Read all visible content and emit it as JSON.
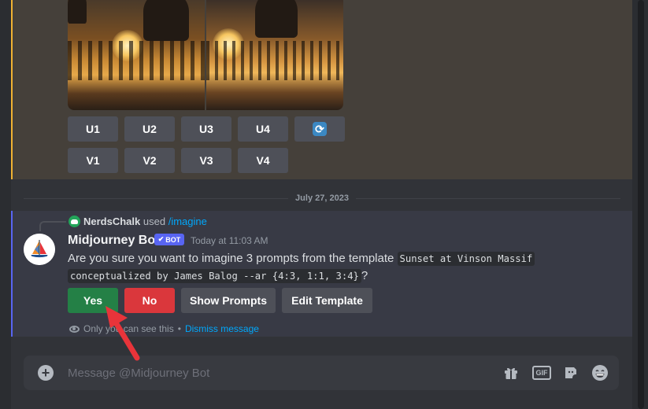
{
  "colors": {
    "background": "#313338",
    "top_message_bg": "#45403a",
    "top_accent": "#f0b232",
    "bottom_message_bg": "#383a45",
    "bottom_accent": "#5865f2",
    "button_secondary": "#4e5058",
    "button_success": "#248046",
    "button_danger": "#da373c",
    "link": "#00a8fc",
    "annotation_arrow": "#e8343a"
  },
  "image_grid": {
    "upscale_buttons": [
      "U1",
      "U2",
      "U3",
      "U4"
    ],
    "reroll_icon": "refresh-icon",
    "variation_buttons": [
      "V1",
      "V2",
      "V3",
      "V4"
    ]
  },
  "date_divider": "July 27, 2023",
  "reply": {
    "icon": "discord-icon",
    "user": "NerdsChalk",
    "used": "used",
    "command": "/imagine"
  },
  "message": {
    "author": "Midjourney Bot",
    "badge": "BOT",
    "timestamp": "Today at 11:03 AM",
    "text_before": "Are you sure you want to imagine 3 prompts from the template",
    "code_line1": "Sunset at Vinson Massif",
    "code_line2": "conceptualized by James Balog --ar {4:3, 1:1, 3:4}",
    "text_after": "?",
    "buttons": {
      "yes": "Yes",
      "no": "No",
      "show_prompts": "Show Prompts",
      "edit_template": "Edit Template"
    },
    "ephemeral_notice": "Only you can see this",
    "separator": "•",
    "dismiss": "Dismiss message"
  },
  "composer": {
    "placeholder": "Message @Midjourney Bot",
    "icons": [
      "plus-icon",
      "gift-icon",
      "gif-icon",
      "sticker-icon",
      "emoji-icon"
    ],
    "gif_label": "GIF"
  }
}
